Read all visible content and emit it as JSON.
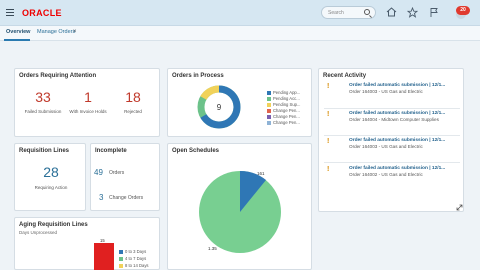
{
  "header": {
    "logo_text": "ORACLE",
    "search_placeholder": "Search",
    "notification_count": "20",
    "icons": [
      "home-icon",
      "star-icon",
      "flag-icon",
      "user-avatar-icon"
    ]
  },
  "tabs": [
    {
      "label": "Overview",
      "active": true
    },
    {
      "label": "Manage Orders",
      "active": false
    }
  ],
  "orders_attention": {
    "title": "Orders Requiring Attention",
    "metrics": [
      {
        "value": "33",
        "label": "Failed Submission"
      },
      {
        "value": "1",
        "label": "With Invoice Holds"
      },
      {
        "value": "18",
        "label": "Rejected"
      }
    ]
  },
  "orders_in_process": {
    "title": "Orders in Process",
    "center_value": "9",
    "legend": [
      "Pending App...",
      "Pending Acc...",
      "Pending Sup...",
      "Change Pen...",
      "Change Pen...",
      "Change Pen..."
    ]
  },
  "requisition_lines": {
    "title": "Requisition Lines",
    "value": "28",
    "label": "Requiring Action"
  },
  "incomplete": {
    "title": "Incomplete",
    "rows": [
      {
        "value": "49",
        "label": "Orders"
      },
      {
        "value": "3",
        "label": "Change Orders"
      }
    ]
  },
  "open_schedules": {
    "title": "Open Schedules",
    "slice_labels": [
      "161",
      "1.35"
    ]
  },
  "aging": {
    "title": "Aging Requisition Lines",
    "subtitle": "Days Unprocessed",
    "bar_label": "15",
    "legend": [
      "0 to 3 Days",
      "4 to 7 Days",
      "8 to 14 Days"
    ]
  },
  "recent_activity": {
    "title": "Recent Activity",
    "items": [
      {
        "link": "Order failed automatic submission | 12/1...",
        "sub": "Order 164003 - US Gas and Electric"
      },
      {
        "link": "Order failed automatic submission | 12/1...",
        "sub": "Order 164004 - Midtown Computer Supplies"
      },
      {
        "link": "Order failed automatic submission | 12/1...",
        "sub": "Order 164003 - US Gas and Electric"
      },
      {
        "link": "Order failed automatic submission | 12/1...",
        "sub": "Order 164002 - US Gas and Electric"
      }
    ]
  },
  "colors": {
    "accent": "#2a6f97",
    "alert_red": "#c0392b",
    "donut_blue": "#2f77b5",
    "donut_yellow": "#f1d25a",
    "donut_green": "#6cc28a",
    "pie_green": "#78cf91",
    "bar_red": "#e02020"
  }
}
